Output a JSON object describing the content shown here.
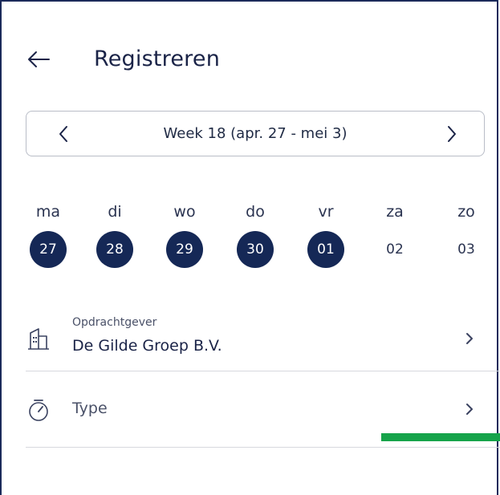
{
  "header": {
    "title": "Registreren",
    "back_icon": "arrow-left-icon"
  },
  "week": {
    "label": "Week 18 (apr. 27 - mei 3)",
    "prev_icon": "chevron-left-icon",
    "next_icon": "chevron-right-icon"
  },
  "days": [
    {
      "name": "ma",
      "num": "27",
      "selected": true
    },
    {
      "name": "di",
      "num": "28",
      "selected": true
    },
    {
      "name": "wo",
      "num": "29",
      "selected": true
    },
    {
      "name": "do",
      "num": "30",
      "selected": true
    },
    {
      "name": "vr",
      "num": "01",
      "selected": true
    },
    {
      "name": "za",
      "num": "02",
      "selected": false
    },
    {
      "name": "zo",
      "num": "03",
      "selected": false
    }
  ],
  "client": {
    "caption": "Opdrachtgever",
    "value": "De Gilde Groep B.V.",
    "icon": "building-icon"
  },
  "type": {
    "label": "Type",
    "icon": "stopwatch-icon"
  },
  "colors": {
    "selected_day": "#152856",
    "accent": "#16a34a",
    "frame": "#1b2a5a"
  }
}
